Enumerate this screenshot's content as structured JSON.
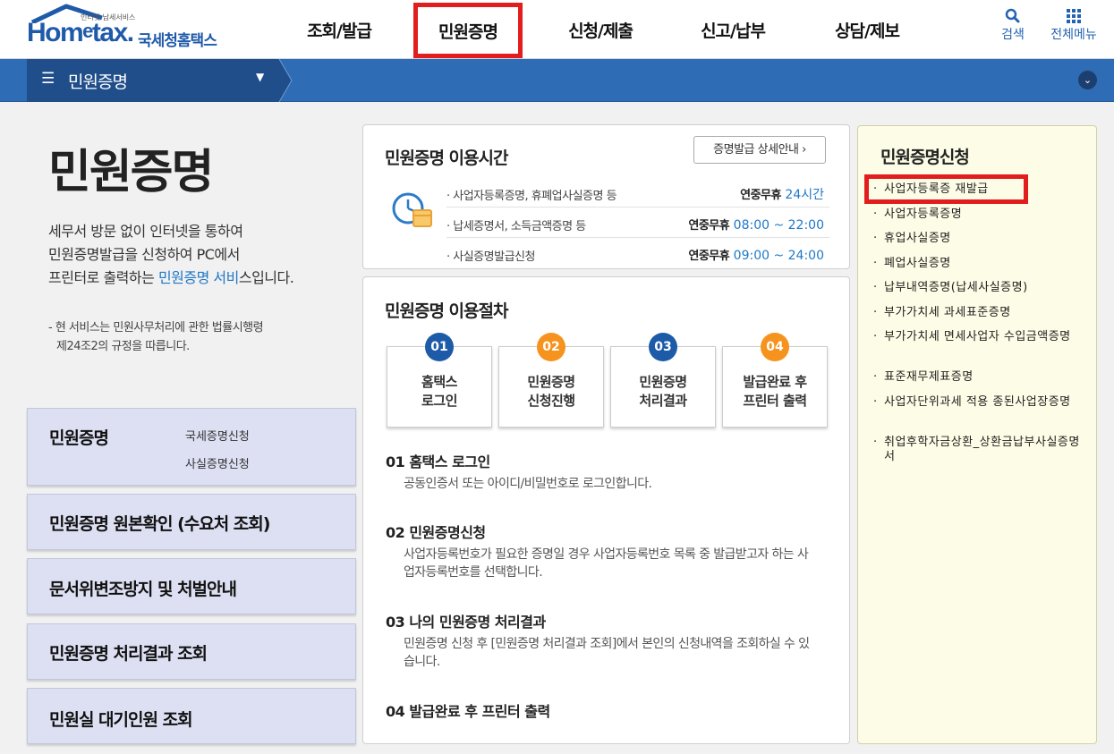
{
  "header": {
    "logo_small": "인터넷 납세서비스",
    "logo_home": "Hom",
    "logo_e": "e",
    "logo_tax": "tax.",
    "logo_name": "국세청홈택스",
    "nav": [
      "조회/발급",
      "민원증명",
      "신청/제출",
      "신고/납부",
      "상담/제보"
    ],
    "active_nav": "민원증명",
    "search_label": "검색",
    "menu_label": "전체메뉴"
  },
  "subbar": {
    "breadcrumb": "민원증명"
  },
  "hero": {
    "title": "민원증명",
    "desc_line1": "세무서 방문 없이 인터넷을 통하여",
    "desc_line2": "민원증명발급을 신청하여 PC에서",
    "desc_line3_pre": "프린터로 출력하는 ",
    "desc_line3_link": "민원증명 서비",
    "desc_line3_post": "스입니다.",
    "note_line1": "- 현 서비스는 민원사무처리에 관한 법률시행령",
    "note_line2": "제24조2의 규정을 따릅니다."
  },
  "left_menu": {
    "box1_title": "민원증명",
    "box1_sub1": "국세증명신청",
    "box1_sub2": "사실증명신청",
    "box2": "민원증명 원본확인 (수요처 조회)",
    "box3": "문서위변조방지 및 처벌안내",
    "box4": "민원증명 처리결과 조회",
    "box5": "민원실 대기인원 조회"
  },
  "hours": {
    "title": "민원증명 이용시간",
    "detail_button": "증명발급 상세안내",
    "rows": [
      {
        "label": "사업자등록증명, 휴폐업사실증명 등",
        "day": "연중무휴",
        "time": "24시간"
      },
      {
        "label": "납세증명서, 소득금액증명 등",
        "day": "연중무휴",
        "time": "08:00 ~ 22:00"
      },
      {
        "label": "사실증명발급신청",
        "day": "연중무휴",
        "time": "09:00 ~ 24:00"
      }
    ]
  },
  "procedure": {
    "title": "민원증명 이용절차",
    "steps": [
      {
        "num": "01",
        "line1": "홈택스",
        "line2": "로그인"
      },
      {
        "num": "02",
        "line1": "민원증명",
        "line2": "신청진행"
      },
      {
        "num": "03",
        "line1": "민원증명",
        "line2": "처리결과"
      },
      {
        "num": "04",
        "line1": "발급완료 후",
        "line2": "프린터 출력"
      }
    ],
    "details": [
      {
        "head": "01 홈택스 로그인",
        "body": "공동인증서 또는 아이디/비밀번호로 로그인합니다."
      },
      {
        "head": "02 민원증명신청",
        "body": "사업자등록번호가 필요한 증명일 경우 사업자등록번호 목록 중 발급받고자 하는 사업자등록번호를 선택합니다."
      },
      {
        "head": "03 나의 민원증명 처리결과",
        "body": "민원증명 신청 후 [민원증명 처리결과 조회]에서 본인의 신청내역을 조회하실 수 있습니다."
      },
      {
        "head": "04 발급완료 후 프린터 출력",
        "body": ""
      }
    ]
  },
  "right_panel": {
    "title": "민원증명신청",
    "items": [
      "사업자등록증 재발급",
      "사업자등록증명",
      "휴업사실증명",
      "폐업사실증명",
      "납부내역증명(납세사실증명)",
      "부가가치세 과세표준증명",
      "부가가치세 면세사업자 수입금액증명",
      "표준재무제표증명",
      "사업자단위과세 적용 종된사업장증명",
      "취업후학자금상환_상환금납부사실증명서"
    ]
  },
  "icons": {
    "search": "search-icon",
    "menu": "grid-menu-icon",
    "hamburger": "hamburger-icon",
    "clock": "clock-calendar-icon",
    "collapse": "chevron-down-icon"
  },
  "colors": {
    "brand_blue": "#2e6cb5",
    "highlight_red": "#e21d1d",
    "step_blue": "#1d5ba8",
    "step_orange": "#f6931e",
    "left_box": "#dde0f3",
    "right_panel": "#fdfce6"
  }
}
